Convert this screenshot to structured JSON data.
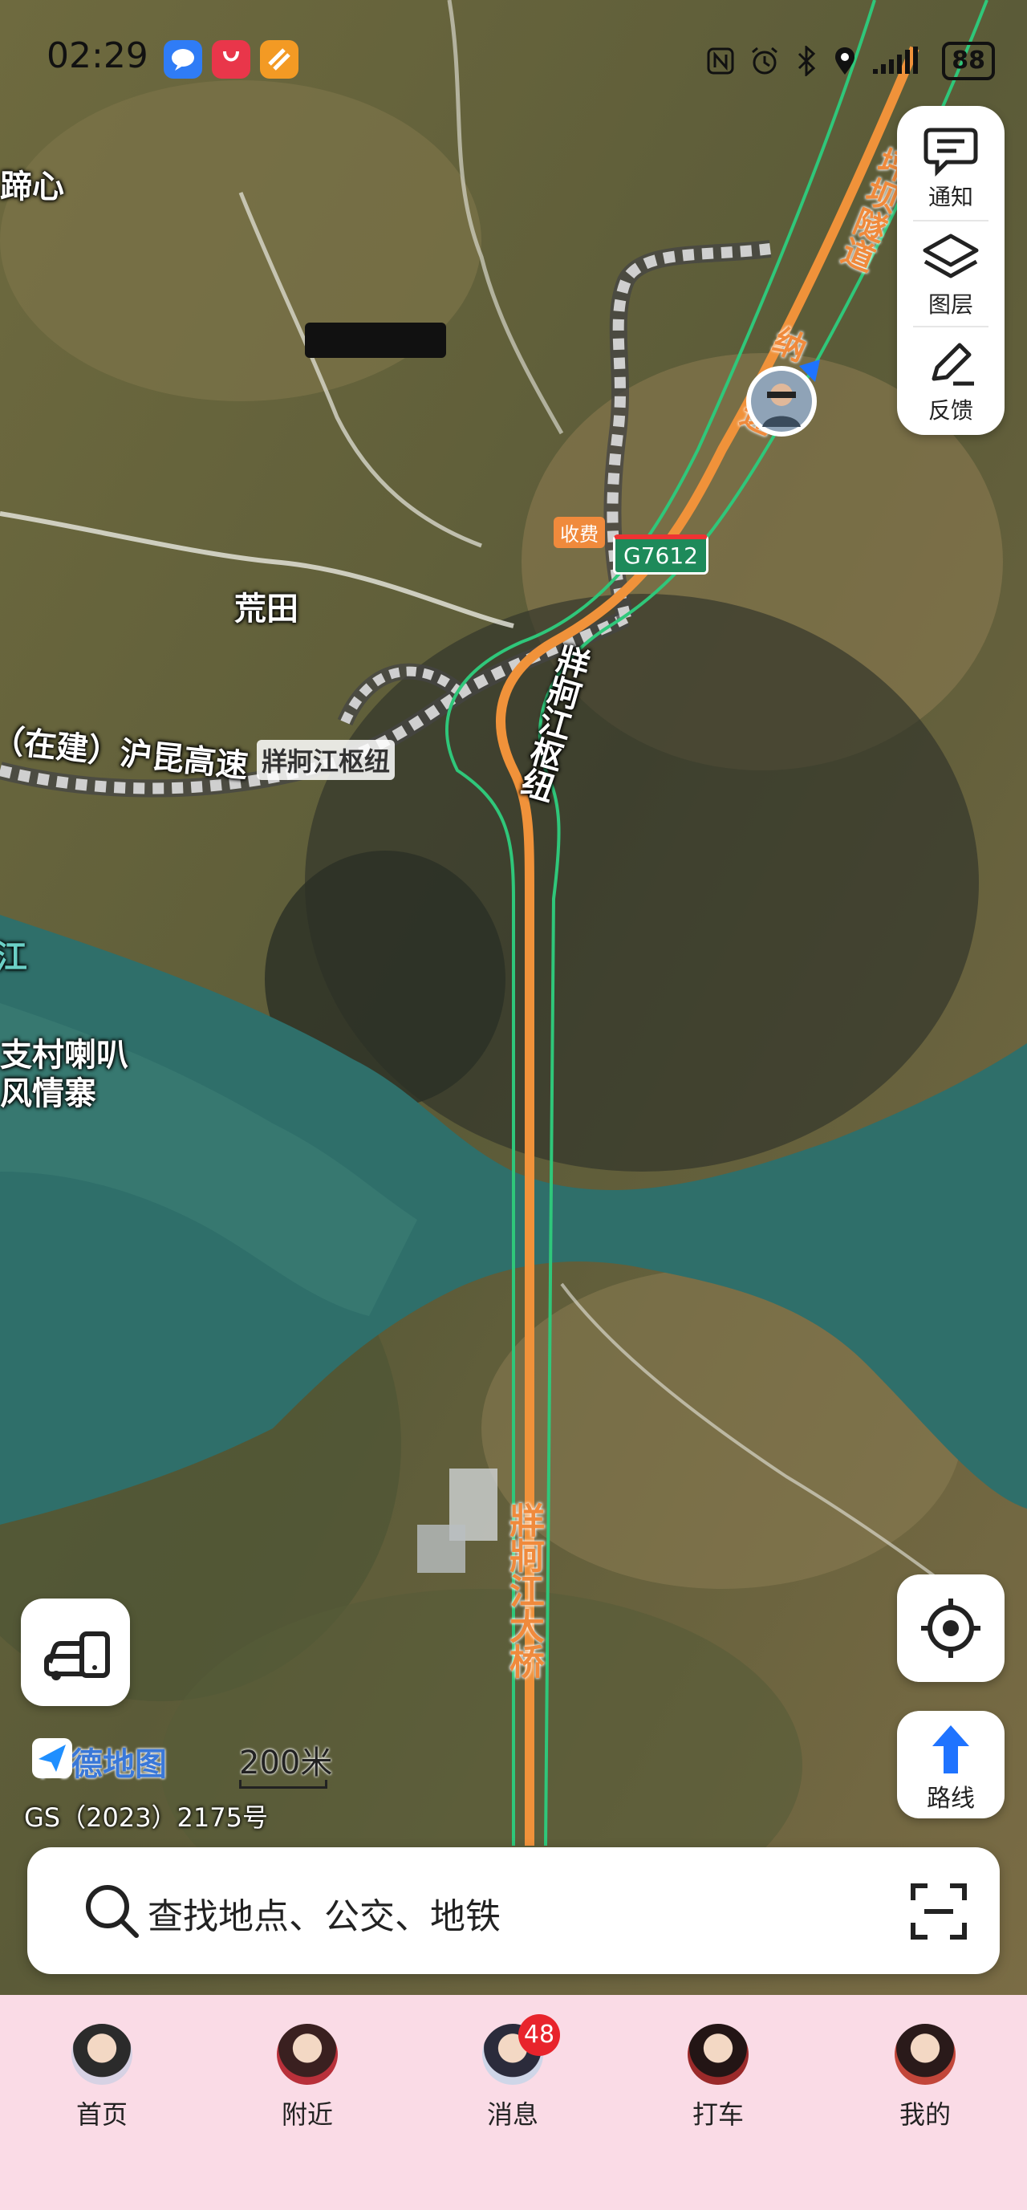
{
  "status_bar": {
    "time": "02:29",
    "battery": "88",
    "icons": [
      "nfc-icon",
      "alarm-icon",
      "bluetooth-icon",
      "location-icon",
      "signal-icon"
    ]
  },
  "map": {
    "labels": {
      "top_left_partial": "蹄心",
      "village": "荒田",
      "highway_under_construction": "（在建）沪昆高速",
      "junction": "牂牁江枢纽",
      "junction_vertical": "牂牁江枢纽",
      "scenic": "支村喇叭\n风情寨",
      "scenic_line1": "支村喇叭",
      "scenic_line2": "风情寨",
      "tunnel_vertical": "坪坝隧道",
      "expressway_vertical": "纳速",
      "bridge_vertical": "牂牁江大桥",
      "toll": "收费",
      "route_shield": "G7612",
      "river_edge": "江"
    },
    "brand": "高德地图",
    "scale": "200米",
    "license": "GS（2023）2175号"
  },
  "right_panel": {
    "notify_label": "通知",
    "layers_label": "图层",
    "feedback_label": "反馈"
  },
  "route_button": {
    "label": "路线"
  },
  "search": {
    "placeholder": "查找地点、公交、地铁"
  },
  "bottom_nav": {
    "items": [
      {
        "label": "首页"
      },
      {
        "label": "附近"
      },
      {
        "label": "消息",
        "badge": "48"
      },
      {
        "label": "打车"
      },
      {
        "label": "我的"
      }
    ]
  },
  "colors": {
    "river": "#2f6f6a",
    "route_orange": "#f0923a",
    "route_green": "#2fc77a",
    "nav_bg": "#fadbe6",
    "badge": "#e8242c",
    "route_button_blue": "#1f73ff"
  }
}
